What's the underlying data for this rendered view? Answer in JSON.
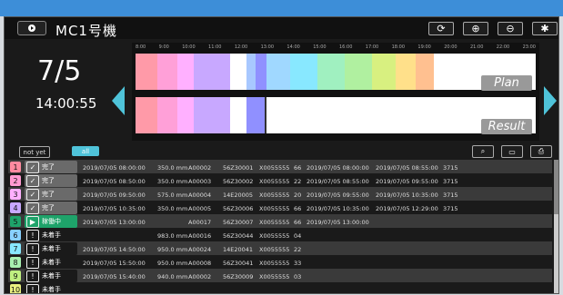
{
  "header": {
    "machine": "MC1号機"
  },
  "current": {
    "date": "7/5",
    "time": "14:00:55"
  },
  "timeline": {
    "plan_label": "Plan",
    "result_label": "Result",
    "tick_labels": [
      "8:00",
      "9:00",
      "10:00",
      "11:00",
      "12:00",
      "13:00",
      "14:00",
      "15:00",
      "16:00",
      "17:00",
      "18:00",
      "19:00",
      "20:00",
      "21:00",
      "22:00",
      "23:00"
    ]
  },
  "filters": {
    "not_yet": "not yet",
    "all": "all"
  },
  "colors": {
    "accent": "#4fc3d9",
    "status_done": "#6a6a6a",
    "status_running": "#1ea36a"
  },
  "rows": [
    {
      "idx": "1",
      "idx_color": "#ff8aa0",
      "status": "完了",
      "icon": "✓",
      "kind": "done",
      "planned": "2019/07/05 08:00:00",
      "qty": "350.0 mm",
      "code": "A00002",
      "part": "56Z30001",
      "mat": "X0055555",
      "n": "66",
      "start": "2019/07/05 08:00:00",
      "end": "2019/07/05 08:55:00",
      "sec": "3715"
    },
    {
      "idx": "2",
      "idx_color": "#ff9ad0",
      "status": "完了",
      "icon": "✓",
      "kind": "done",
      "planned": "2019/07/05 08:50:00",
      "qty": "350.0 mm",
      "code": "A00003",
      "part": "56Z30002",
      "mat": "X0055555",
      "n": "22",
      "start": "2019/07/05 08:55:00",
      "end": "2019/07/05 09:55:00",
      "sec": "3715"
    },
    {
      "idx": "3",
      "idx_color": "#ffb0ff",
      "status": "完了",
      "icon": "✓",
      "kind": "done",
      "planned": "2019/07/05 09:50:00",
      "qty": "575.0 mm",
      "code": "A00004",
      "part": "14E20005",
      "mat": "X0055555",
      "n": "20",
      "start": "2019/07/05 09:55:00",
      "end": "2019/07/05 10:35:00",
      "sec": "3715"
    },
    {
      "idx": "4",
      "idx_color": "#c8a8ff",
      "status": "完了",
      "icon": "✓",
      "kind": "done",
      "planned": "2019/07/05 10:35:00",
      "qty": "350.0 mm",
      "code": "A00005",
      "part": "56Z30006",
      "mat": "X0055555",
      "n": "66",
      "start": "2019/07/05 10:35:00",
      "end": "2019/07/05 12:29:00",
      "sec": "3715"
    },
    {
      "idx": "5",
      "idx_color": "#1ea36a",
      "status": "稼働中",
      "icon": "▶",
      "kind": "running",
      "planned": "2019/07/05 13:00:00",
      "qty": "",
      "code": "A00017",
      "part": "56Z30007",
      "mat": "X0055555",
      "n": "66",
      "start": "2019/07/05 13:00:00",
      "end": "",
      "sec": ""
    },
    {
      "idx": "6",
      "idx_color": "#88d0ff",
      "status": "未着手",
      "icon": "!",
      "kind": "todo",
      "planned": "",
      "qty": "983.0 mm",
      "code": "A00016",
      "part": "56Z30044",
      "mat": "X0055555",
      "n": "04",
      "start": "",
      "end": "",
      "sec": ""
    },
    {
      "idx": "7",
      "idx_color": "#88e8ff",
      "status": "未着手",
      "icon": "!",
      "kind": "todo",
      "planned": "2019/07/05 14:50:00",
      "qty": "950.0 mm",
      "code": "A00024",
      "part": "14E20041",
      "mat": "X0055555",
      "n": "22",
      "start": "",
      "end": "",
      "sec": ""
    },
    {
      "idx": "8",
      "idx_color": "#a8f0b0",
      "status": "未着手",
      "icon": "!",
      "kind": "todo",
      "planned": "2019/07/05 15:50:00",
      "qty": "950.0 mm",
      "code": "A00008",
      "part": "56Z30041",
      "mat": "X0055555",
      "n": "33",
      "start": "",
      "end": "",
      "sec": ""
    },
    {
      "idx": "9",
      "idx_color": "#c0f080",
      "status": "未着手",
      "icon": "!",
      "kind": "todo",
      "planned": "2019/07/05 15:40:00",
      "qty": "940.0 mm",
      "code": "A00002",
      "part": "56Z30009",
      "mat": "X0055555",
      "n": "03",
      "start": "",
      "end": "",
      "sec": ""
    },
    {
      "idx": "10",
      "idx_color": "#e8f080",
      "status": "未着手",
      "icon": "!",
      "kind": "todo",
      "planned": "",
      "qty": "",
      "code": "",
      "part": "",
      "mat": "",
      "n": "",
      "start": "",
      "end": "",
      "sec": ""
    }
  ]
}
